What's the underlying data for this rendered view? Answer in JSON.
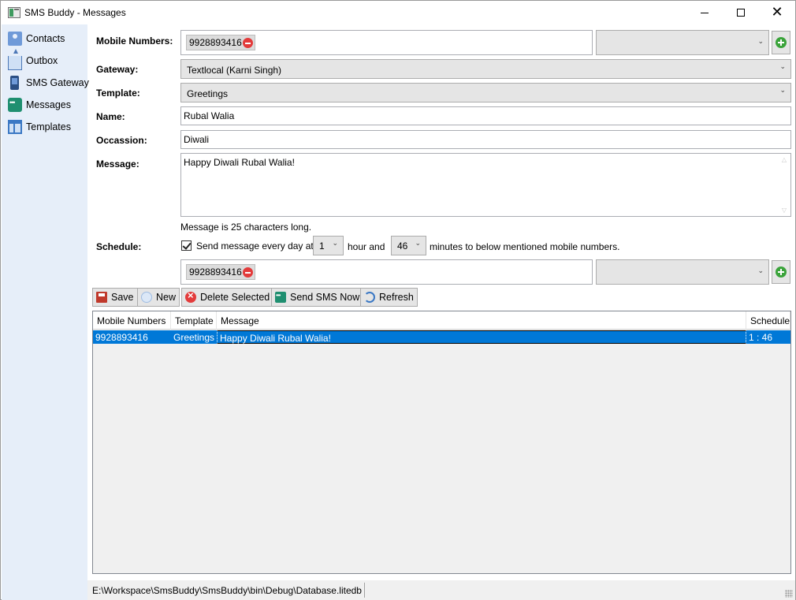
{
  "window": {
    "title": "SMS Buddy - Messages",
    "minimize_icon": "minimize-icon",
    "maximize_icon": "maximize-icon",
    "close_icon": "close-icon"
  },
  "sidebar": {
    "items": [
      {
        "label": "Contacts",
        "icon": "contacts-icon"
      },
      {
        "label": "Outbox",
        "icon": "outbox-icon"
      },
      {
        "label": "SMS Gateway",
        "icon": "gateway-icon"
      },
      {
        "label": "Messages",
        "icon": "messages-icon"
      },
      {
        "label": "Templates",
        "icon": "templates-icon"
      }
    ]
  },
  "form": {
    "mobile_numbers_label": "Mobile Numbers:",
    "mobile_numbers_chip": "9928893416",
    "gateway_label": "Gateway:",
    "gateway_value": "Textlocal (Karni Singh)",
    "template_label": "Template:",
    "template_value": "Greetings",
    "name_label": "Name:",
    "name_value": "Rubal Walia",
    "occasion_label": "Occassion:",
    "occasion_value": "Diwali",
    "message_label": "Message:",
    "message_value": "Happy Diwali Rubal Walia!",
    "message_length_text": "Message is 25 characters long.",
    "schedule_label": "Schedule:",
    "schedule_checked": true,
    "schedule_prefix": "Send message every day at",
    "schedule_hour": "1",
    "schedule_mid": "hour and",
    "schedule_minutes": "46",
    "schedule_suffix": "minutes to below mentioned mobile numbers.",
    "schedule_numbers_chip": "9928893416"
  },
  "toolbar": {
    "save_label": "Save",
    "new_label": "New",
    "delete_label": "Delete Selected",
    "send_label": "Send SMS Now",
    "refresh_label": "Refresh"
  },
  "grid": {
    "columns": [
      "Mobile Numbers",
      "Template",
      "Message",
      "Schedule"
    ],
    "rows": [
      {
        "mobile": "9928893416",
        "template": "Greetings",
        "message": "Happy Diwali Rubal Walia!",
        "schedule": "1 : 46"
      }
    ]
  },
  "status": {
    "path": "E:\\Workspace\\SmsBuddy\\SmsBuddy\\bin\\Debug\\Database.litedb"
  },
  "colors": {
    "sidebar_bg": "#e6eef9",
    "selection": "#0078d7",
    "add_green": "#3aa33a",
    "remove_red": "#e33b3b"
  }
}
